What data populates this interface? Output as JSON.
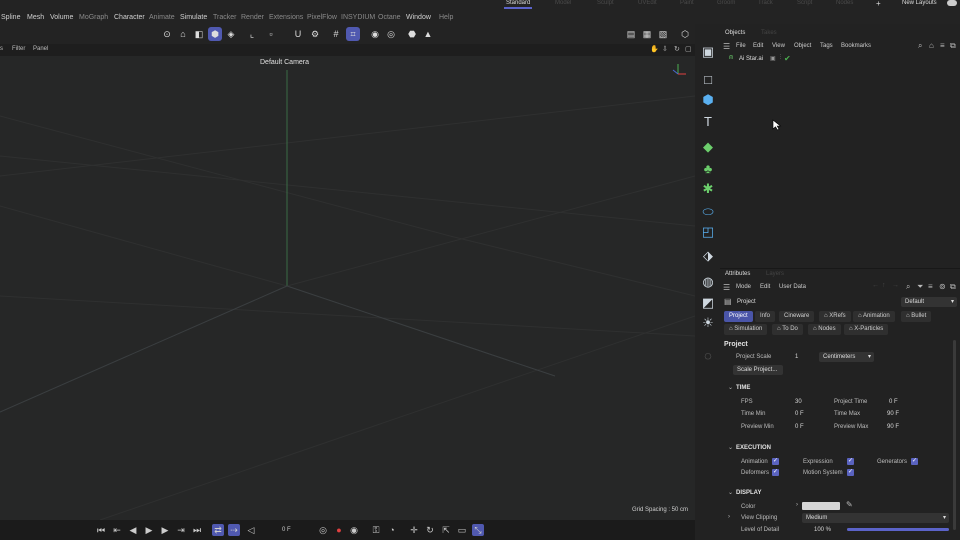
{
  "menu": {
    "items": [
      "Spline",
      "Mesh",
      "Volume",
      "MoGraph",
      "Character",
      "Animate",
      "Simulate",
      "Tracker",
      "Render",
      "Extensions",
      "PixelFlow",
      "INSYDIUM",
      "Octane",
      "Window",
      "Help"
    ],
    "layouts": [
      "Standard",
      "Model",
      "Sculpt",
      "UVEdit",
      "Paint",
      "Groom",
      "Track",
      "Script",
      "Nodes"
    ],
    "new_layouts": "New Layouts"
  },
  "viewport": {
    "menu": [
      "s",
      "Filter",
      "Panel"
    ],
    "camera": "Default Camera",
    "grid_spacing": "Grid Spacing : 50 cm"
  },
  "timeline": {
    "frame": "0 F"
  },
  "objects": {
    "tabs": [
      "Objects",
      "Takes"
    ],
    "menu": [
      "File",
      "Edit",
      "View",
      "Object",
      "Tags",
      "Bookmarks"
    ],
    "item": "Ai Star.ai"
  },
  "attributes": {
    "tabs": [
      "Attributes",
      "Layers"
    ],
    "menu": [
      "Mode",
      "Edit",
      "User Data"
    ],
    "title": "Project",
    "preset": "Default",
    "tabs_row1": [
      "Project",
      "Info",
      "Cineware",
      "XRefs",
      "Animation",
      "Bullet"
    ],
    "tabs_row2": [
      "Simulation",
      "To Do",
      "Nodes",
      "X-Particles"
    ],
    "section": "Project",
    "project_scale_label": "Project Scale",
    "project_scale_value": "1",
    "project_scale_unit": "Centimeters",
    "scale_button": "Scale Project...",
    "time": {
      "header": "TIME",
      "fps_label": "FPS",
      "fps": "30",
      "project_time_label": "Project Time",
      "project_time": "0 F",
      "time_min_label": "Time Min",
      "time_min": "0 F",
      "time_max_label": "Time Max",
      "time_max": "90 F",
      "preview_min_label": "Preview Min",
      "preview_min": "0 F",
      "preview_max_label": "Preview Max",
      "preview_max": "90 F"
    },
    "execution": {
      "header": "EXECUTION",
      "animation": "Animation",
      "expression": "Expression",
      "generators": "Generators",
      "deformers": "Deformers",
      "motion_system": "Motion System"
    },
    "display": {
      "header": "DISPLAY",
      "color_label": "Color",
      "view_clipping_label": "View Clipping",
      "view_clipping": "Medium",
      "lod_label": "Level of Detail",
      "lod": "100 %",
      "lod_fraction": 1.0
    }
  },
  "colors": {
    "accent": "#5059b0",
    "viewport_bg": "#262727",
    "panel_bg": "#222222",
    "check_green": "#4caf50"
  }
}
